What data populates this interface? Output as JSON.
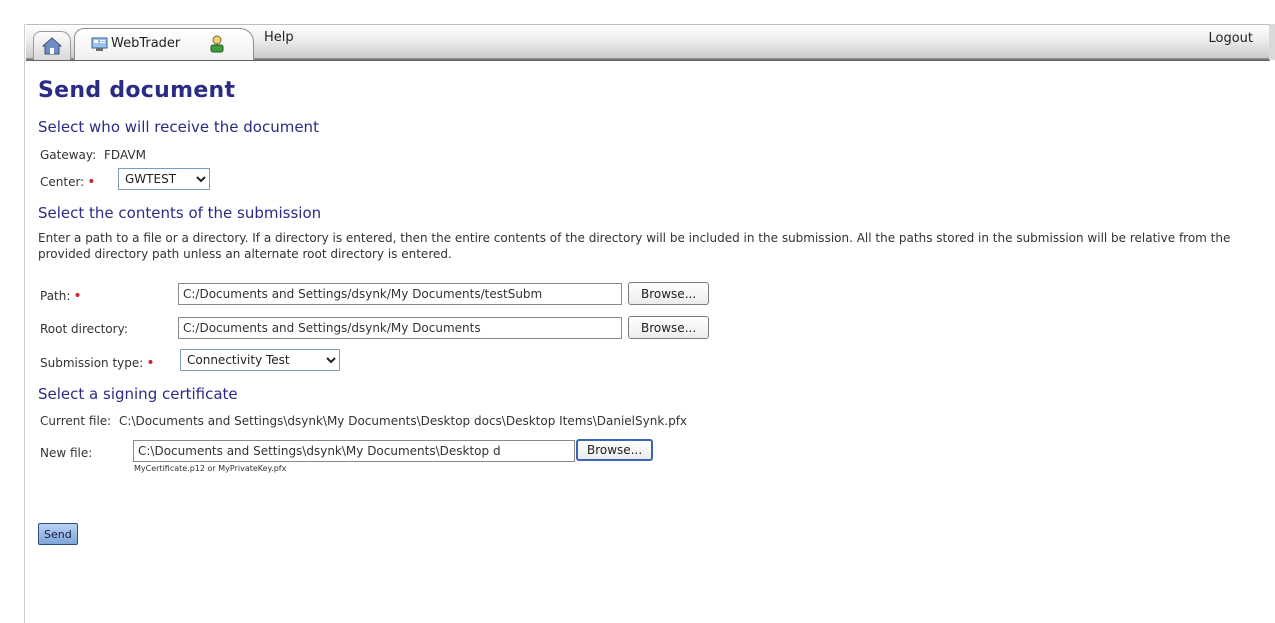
{
  "nav": {
    "app_tab_label": "WebTrader",
    "help_label": "Help",
    "logout_label": "Logout"
  },
  "page": {
    "title": "Send document"
  },
  "recipient": {
    "section_title": "Select who will receive the document",
    "gateway_label": "Gateway:",
    "gateway_value": "FDAVM",
    "center_label": "Center:",
    "center_value": "GWTEST"
  },
  "submission": {
    "section_title": "Select the contents of the submission",
    "description": "Enter a path to a file or a directory. If a directory is entered, then the entire contents of the directory will be included in the submission. All the paths stored in the submission will be relative from the provided directory path unless an alternate root directory is entered.",
    "path_label": "Path:",
    "path_value": "C:/Documents and Settings/dsynk/My Documents/testSubm",
    "root_label": "Root directory:",
    "root_value": "C:/Documents and Settings/dsynk/My Documents",
    "type_label": "Submission type:",
    "type_value": "Connectivity Test",
    "browse_label": "Browse..."
  },
  "certificate": {
    "section_title": "Select a signing certificate",
    "current_label": "Current file:",
    "current_value": "C:\\Documents and Settings\\dsynk\\My Documents\\Desktop docs\\Desktop Items\\DanielSynk.pfx",
    "new_label": "New file:",
    "new_value": "C:\\Documents and Settings\\dsynk\\My Documents\\Desktop d",
    "browse_label": "Browse...",
    "hint": "MyCertificate.p12 or MyPrivateKey.pfx"
  },
  "actions": {
    "send_label": "Send"
  },
  "colors": {
    "heading": "#2b2b86",
    "required_marker": "#d0232a",
    "send_button": "#7fa5d8"
  }
}
